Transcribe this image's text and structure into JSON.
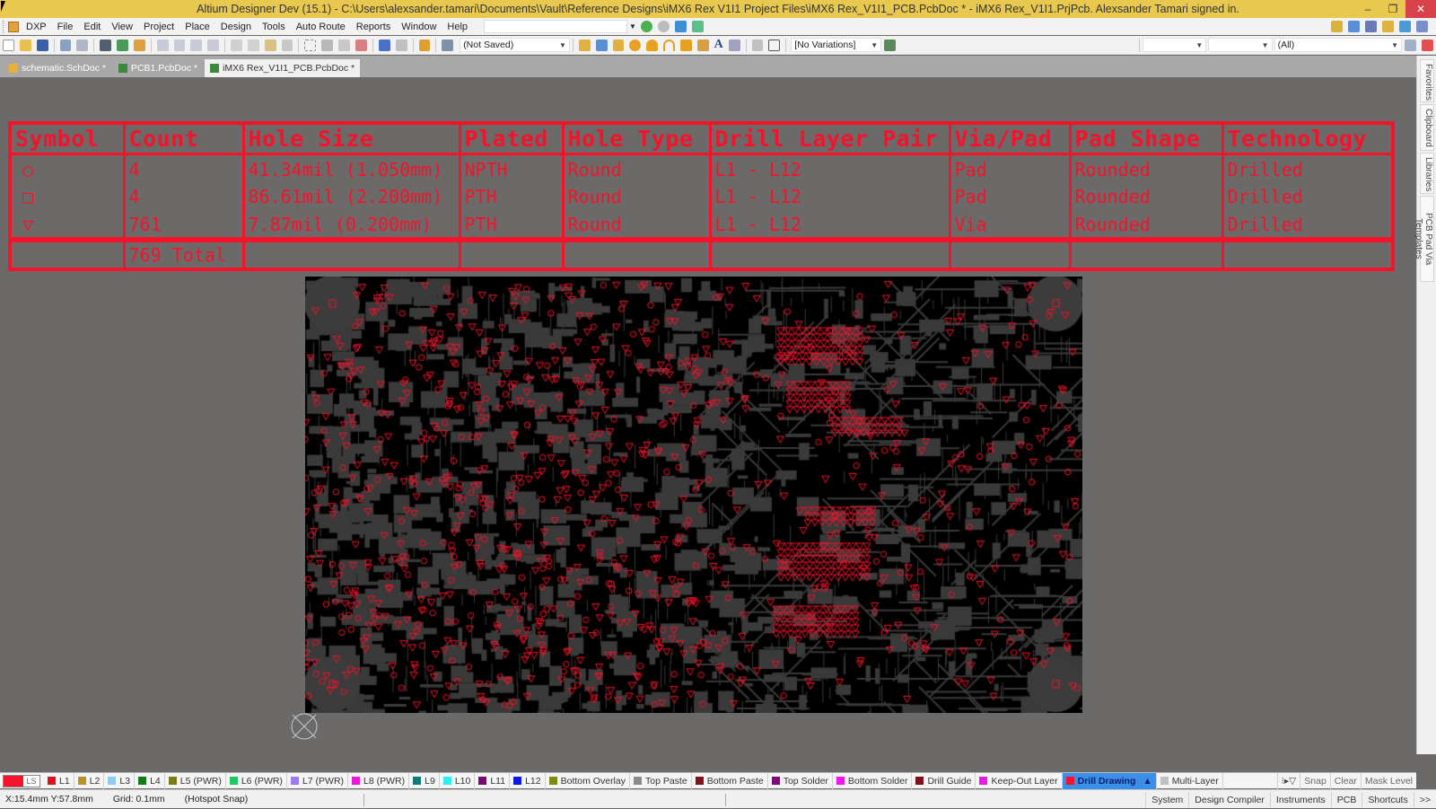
{
  "window": {
    "title": "Altium Designer Dev (15.1) - C:\\Users\\alexsander.tamari\\Documents\\Vault\\Reference Designs\\iMX6 Rex V1I1 Project Files\\iMX6 Rex_V1I1_PCB.PcbDoc * - iMX6 Rex_V1I1.PrjPcb. Alexsander Tamari signed in.",
    "minimize": "–",
    "restore": "❐",
    "close": "✕"
  },
  "menu": {
    "items": [
      "DXP",
      "File",
      "Edit",
      "View",
      "Project",
      "Place",
      "Design",
      "Tools",
      "Auto Route",
      "Reports",
      "Window",
      "Help"
    ]
  },
  "toolbar": {
    "saved_state": "(Not Saved)",
    "variations": "[No Variations]",
    "filter_combo1": "",
    "filter_combo2": "",
    "filter_scope": "(All)"
  },
  "tabs": [
    {
      "label": "schematic.SchDoc *",
      "icon": "schematic-doc-icon",
      "active": false
    },
    {
      "label": "PCB1.PcbDoc *",
      "icon": "pcb-doc-icon",
      "active": false
    },
    {
      "label": "iMX6 Rex_V1I1_PCB.PcbDoc *",
      "icon": "pcb-doc-icon",
      "active": true
    }
  ],
  "side_panels": [
    "Favorites",
    "Clipboard",
    "Libraries",
    "PCB Pad Via Templates"
  ],
  "drill_table": {
    "headers": [
      "Symbol",
      "Count",
      "Hole Size",
      "Plated",
      "Hole Type",
      "Drill Layer Pair",
      "Via/Pad",
      "Pad Shape",
      "Technology"
    ],
    "rows": [
      {
        "symbol": "○",
        "count": "4",
        "hole_size": "41.34mil (1.050mm)",
        "plated": "NPTH",
        "hole_type": "Round",
        "layer_pair": "L1 - L12",
        "via_pad": "Pad",
        "pad_shape": "Rounded",
        "technology": "Drilled"
      },
      {
        "symbol": "□",
        "count": "4",
        "hole_size": "86.61mil (2.200mm)",
        "plated": "PTH",
        "hole_type": "Round",
        "layer_pair": "L1 - L12",
        "via_pad": "Pad",
        "pad_shape": "Rounded",
        "technology": "Drilled"
      },
      {
        "symbol": "▽",
        "count": "761",
        "hole_size": "7.87mil (0.200mm)",
        "plated": "PTH",
        "hole_type": "Round",
        "layer_pair": "L1 - L12",
        "via_pad": "Via",
        "pad_shape": "Rounded",
        "technology": "Drilled"
      }
    ],
    "total": "769 Total"
  },
  "current_layer": {
    "label": "LS",
    "color": "#f4132b"
  },
  "layers": [
    {
      "label": "L1",
      "color": "#e0101a"
    },
    {
      "label": "L2",
      "color": "#b8922a"
    },
    {
      "label": "L3",
      "color": "#8ecdf0"
    },
    {
      "label": "L4",
      "color": "#12781a"
    },
    {
      "label": "L5 (PWR)",
      "color": "#7d7a1a"
    },
    {
      "label": "L6 (PWR)",
      "color": "#1ec866"
    },
    {
      "label": "L7 (PWR)",
      "color": "#9a7cf0"
    },
    {
      "label": "L8 (PWR)",
      "color": "#f018d8"
    },
    {
      "label": "L9",
      "color": "#127a7a"
    },
    {
      "label": "L10",
      "color": "#2ef0f0"
    },
    {
      "label": "L11",
      "color": "#780a78"
    },
    {
      "label": "L12",
      "color": "#0a1ae0"
    },
    {
      "label": "Bottom Overlay",
      "color": "#7f8a14"
    },
    {
      "label": "Top Paste",
      "color": "#8a8a8a"
    },
    {
      "label": "Bottom Paste",
      "color": "#80101a"
    },
    {
      "label": "Top Solder",
      "color": "#7a0a7a"
    },
    {
      "label": "Bottom Solder",
      "color": "#f018e8"
    },
    {
      "label": "Drill Guide",
      "color": "#80101a"
    },
    {
      "label": "Keep-Out Layer",
      "color": "#f018e8"
    },
    {
      "label": "Drill Drawing",
      "color": "#f4132b",
      "active": true,
      "suffix": "▲"
    },
    {
      "label": "Multi-Layer",
      "color": "#c0c0c0"
    }
  ],
  "layerbar_right": [
    "Snap",
    "Clear",
    "Mask Level"
  ],
  "status": {
    "coords": "X:15.4mm Y:57.8mm",
    "grid": "Grid: 0.1mm",
    "snap": "(Hotspot Snap)"
  },
  "status_buttons": [
    "System",
    "Design Compiler",
    "Instruments",
    "PCB",
    "Shortcuts",
    ">>"
  ],
  "colors": {
    "drill_drawing": "#f4132b",
    "board": "#000000",
    "copper": "#3a3a3a",
    "workspace": "#6c6a69"
  }
}
